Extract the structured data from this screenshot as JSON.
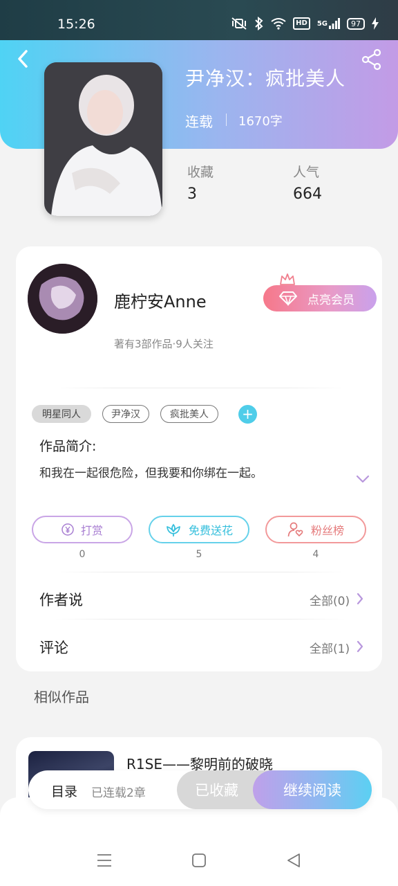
{
  "status_bar": {
    "time": "15:26",
    "network": "5G",
    "hd": "HD",
    "battery": "97"
  },
  "book": {
    "title": "尹净汉：疯批美人",
    "status": "连载",
    "word_count": "1670字",
    "stats": [
      {
        "label": "收藏",
        "value": "3"
      },
      {
        "label": "人气",
        "value": "664"
      }
    ]
  },
  "author": {
    "name": "鹿柠安Anne",
    "info": "著有3部作品·9人关注",
    "vip_label": "点亮会员"
  },
  "tags": [
    "明星同人",
    "尹净汉",
    "疯批美人"
  ],
  "add_tag": "+",
  "intro": {
    "label": "作品简介:",
    "text": "和我在一起很危险，但我要和你绑在一起。"
  },
  "actions": [
    {
      "label": "打赏",
      "count": "0"
    },
    {
      "label": "免费送花",
      "count": "5"
    },
    {
      "label": "粉丝榜",
      "count": "4"
    }
  ],
  "rows": [
    {
      "label": "作者说",
      "all": "全部(0)"
    },
    {
      "label": "评论",
      "all": "全部(1)"
    }
  ],
  "similar": {
    "label": "相似作品",
    "items": [
      {
        "title": "R1SE——黎明前的破晓"
      }
    ]
  },
  "bottom_bar": {
    "toc_label": "目录",
    "toc_count": "已连载2章",
    "collected_label": "已收藏",
    "continue_label": "继续阅读"
  }
}
